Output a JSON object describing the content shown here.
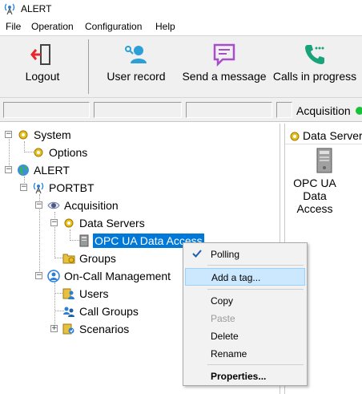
{
  "window": {
    "title": "ALERT"
  },
  "menu": [
    "File",
    "Operation",
    "Configuration",
    "Help"
  ],
  "toolbar": {
    "logout": "Logout",
    "user_record": "User record",
    "send_message": "Send a message",
    "calls_in_progress": "Calls in progress"
  },
  "status": {
    "acquisition": "Acquisition",
    "acquisition_color": "#19c13a"
  },
  "tree": {
    "system": "System",
    "options": "Options",
    "alert": "ALERT",
    "portbt": "PORTBT",
    "acquisition": "Acquisition",
    "data_servers": "Data Servers",
    "opc": "OPC UA Data Access",
    "groups": "Groups",
    "oncall": "On-Call Management",
    "users": "Users",
    "call_groups": "Call Groups",
    "scenarios": "Scenarios"
  },
  "right_panel": {
    "header": "Data Server",
    "item_line1": "OPC UA Data",
    "item_line2": "Access"
  },
  "context_menu": {
    "polling": "Polling",
    "add_tag": "Add a tag...",
    "copy": "Copy",
    "paste": "Paste",
    "delete": "Delete",
    "rename": "Rename",
    "properties": "Properties..."
  },
  "colors": {
    "selection": "#0078d7",
    "menu_highlight": "#cce8ff",
    "logout_red": "#e8272b",
    "user_blue": "#2a9fd8",
    "message_purple": "#a64fc8",
    "calls_teal": "#1aa37a"
  }
}
